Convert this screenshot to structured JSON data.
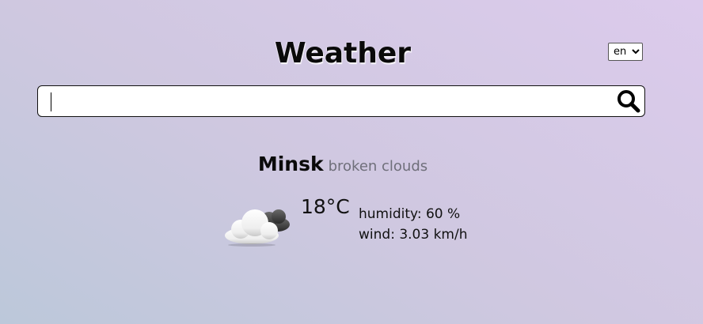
{
  "header": {
    "title": "Weather",
    "language": {
      "selected": "en",
      "options": [
        "en"
      ]
    }
  },
  "search": {
    "value": "",
    "placeholder": "",
    "button_icon": "search-icon"
  },
  "current": {
    "city": "Minsk",
    "description": "broken clouds",
    "icon": "broken-clouds-icon",
    "temperature": "18°C",
    "humidity": "humidity: 60 %",
    "wind": "wind: 3.03 km/h"
  }
}
